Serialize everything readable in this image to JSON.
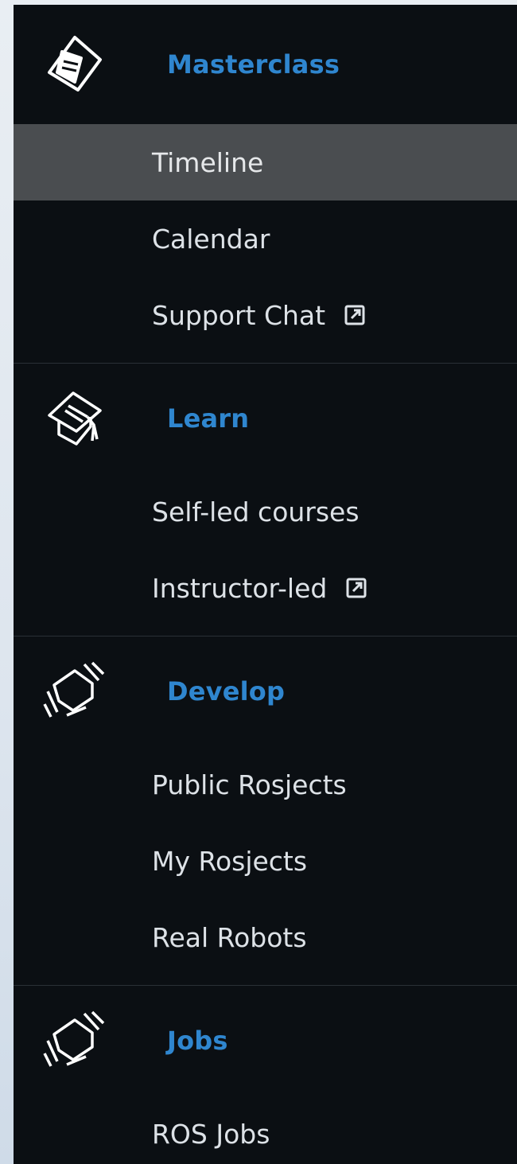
{
  "sections": [
    {
      "title": "Masterclass",
      "icon": "masterclass-icon",
      "items": [
        {
          "label": "Timeline",
          "active": true,
          "external": false
        },
        {
          "label": "Calendar",
          "active": false,
          "external": false
        },
        {
          "label": "Support Chat",
          "active": false,
          "external": true
        }
      ]
    },
    {
      "title": "Learn",
      "icon": "graduation-cap-icon",
      "items": [
        {
          "label": "Self-led courses",
          "active": false,
          "external": false
        },
        {
          "label": "Instructor-led",
          "active": false,
          "external": true
        }
      ]
    },
    {
      "title": "Develop",
      "icon": "develop-icon",
      "items": [
        {
          "label": "Public Rosjects",
          "active": false,
          "external": false
        },
        {
          "label": "My Rosjects",
          "active": false,
          "external": false
        },
        {
          "label": "Real Robots",
          "active": false,
          "external": false
        }
      ]
    },
    {
      "title": "Jobs",
      "icon": "jobs-icon",
      "items": [
        {
          "label": "ROS Jobs",
          "active": false,
          "external": false
        }
      ]
    }
  ],
  "colors": {
    "sidebar_bg": "#0b0f13",
    "section_title": "#2f86cf",
    "item_text": "#dde2e7",
    "active_bg": "#4a4d50"
  }
}
